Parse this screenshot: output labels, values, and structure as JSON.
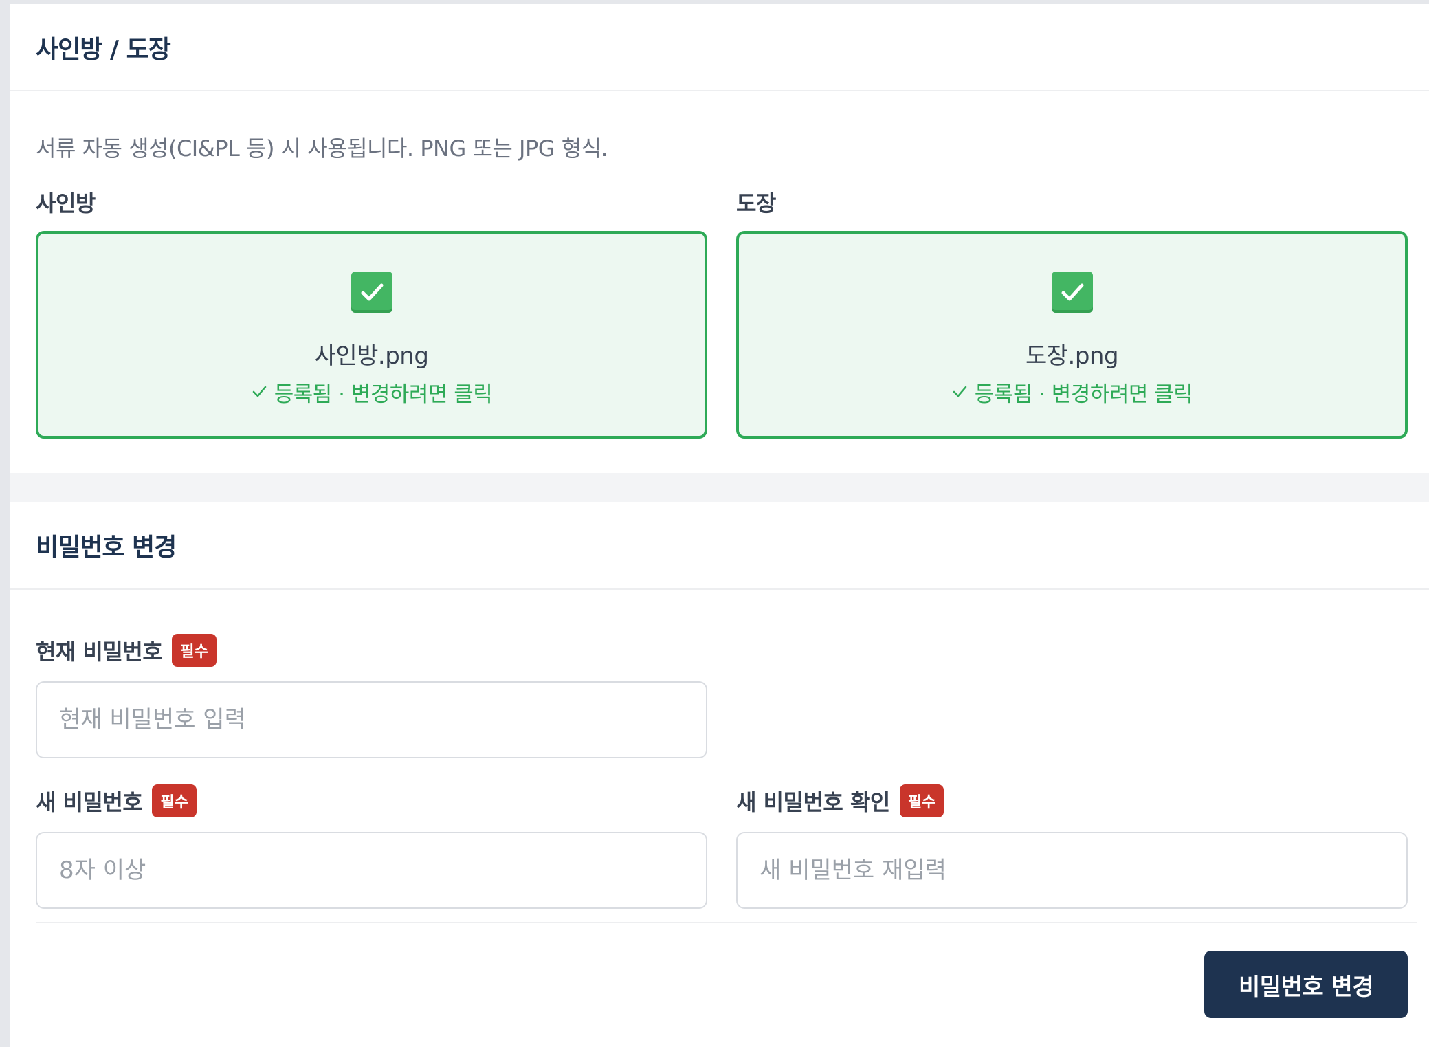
{
  "seal_section": {
    "title": "사인방 / 도장",
    "description": "서류 자동 생성(CI&PL 등) 시 사용됩니다. PNG 또는 JPG 형식.",
    "signature": {
      "label": "사인방",
      "file_name": "사인방.png",
      "status": "등록됨 · 변경하려면 클릭"
    },
    "stamp": {
      "label": "도장",
      "file_name": "도장.png",
      "status": "등록됨 · 변경하려면 클릭"
    }
  },
  "password_section": {
    "title": "비밀번호 변경",
    "current": {
      "label": "현재 비밀번호",
      "badge": "필수",
      "placeholder": "현재 비밀번호 입력",
      "value": ""
    },
    "new": {
      "label": "새 비밀번호",
      "badge": "필수",
      "placeholder": "8자 이상",
      "value": ""
    },
    "confirm": {
      "label": "새 비밀번호 확인",
      "badge": "필수",
      "placeholder": "새 비밀번호 재입력",
      "value": ""
    },
    "submit_label": "비밀번호 변경"
  },
  "colors": {
    "primary": "#1e3350",
    "success": "#2eaa57",
    "required_badge": "#c9352b"
  }
}
